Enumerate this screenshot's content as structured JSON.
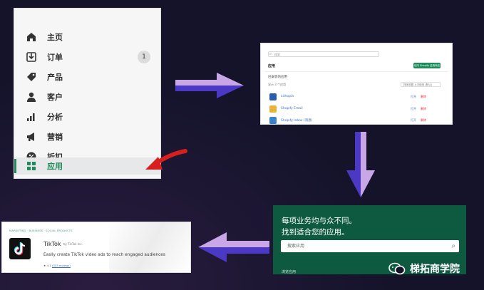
{
  "sidebar": {
    "items": [
      {
        "label": "主页",
        "icon": "home-icon"
      },
      {
        "label": "订单",
        "icon": "orders-icon",
        "badge": "1"
      },
      {
        "label": "产品",
        "icon": "tag-icon"
      },
      {
        "label": "客户",
        "icon": "person-icon"
      },
      {
        "label": "分析",
        "icon": "bar-chart-icon"
      },
      {
        "label": "营销",
        "icon": "megaphone-icon"
      },
      {
        "label": "折扣",
        "icon": "discount-icon"
      },
      {
        "label": "应用",
        "icon": "apps-grid-icon",
        "active": true
      }
    ]
  },
  "apps_page": {
    "search": "搜索",
    "title": "应用",
    "cta": "访问 Shopify 应用商店",
    "section": "已安装的应用",
    "filter": "显示 3 个应用",
    "sort": "排序依据 上次使用 (默认)",
    "rows": [
      {
        "name": "Lithopia",
        "color": "#2a5db0",
        "act1": "打开",
        "act2": "删除"
      },
      {
        "name": "Shopify Email",
        "color": "#e7b33b",
        "act1": "打开",
        "act2": "删除"
      },
      {
        "name": "Shopify Inbox (消息)",
        "color": "#3a83c9",
        "act1": "打开",
        "act2": "删除"
      }
    ]
  },
  "store_search": {
    "heading_line1": "每项业务均与众不同。",
    "heading_line2": "找到适合您的应用。",
    "placeholder": "搜索应用",
    "footer": "浏览应用"
  },
  "app_card": {
    "category": "MARKETING · BUSINESS · SOCIAL PRODUCTS",
    "name": "TikTok",
    "by": "by TikTok Inc.",
    "description": "Easily create TikTok video ads to reach engaged audiences",
    "rating": "★ 4.1",
    "reviews": "(333 reviews)"
  },
  "brand": {
    "name": "梯拓商学院"
  },
  "colors": {
    "arrow_light": "#c9a6e6",
    "arrow_dark": "#4b38c4",
    "pointer_red": "#d71f1f",
    "green": "#0e5a40"
  }
}
